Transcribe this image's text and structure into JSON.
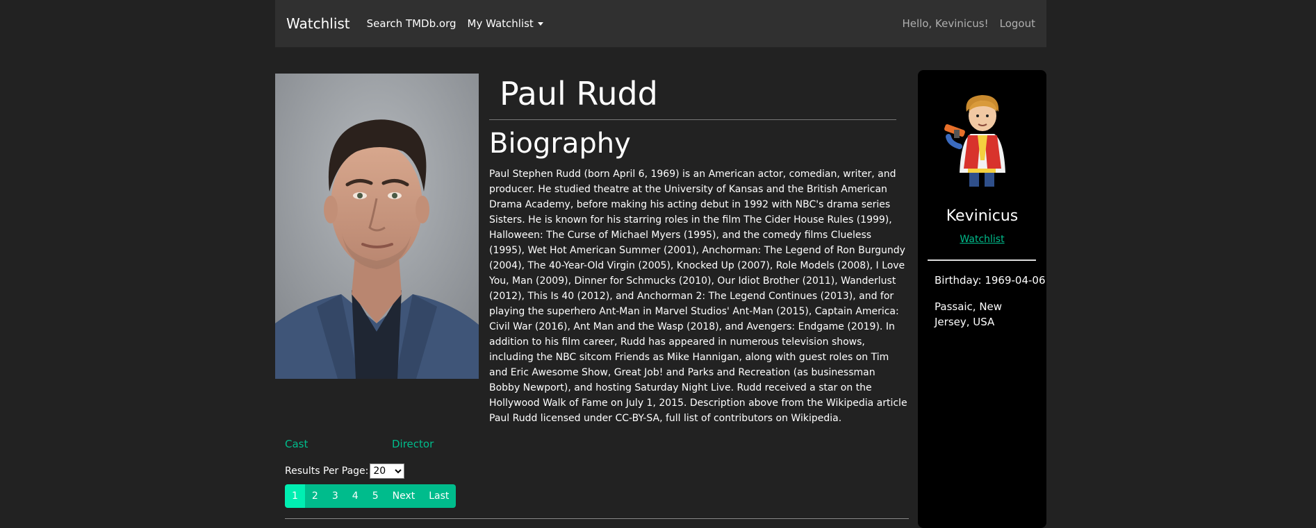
{
  "navbar": {
    "brand": "Watchlist",
    "search": "Search TMDb.org",
    "my_watchlist": "My Watchlist",
    "greeting": "Hello, Kevinicus!",
    "logout": "Logout"
  },
  "person": {
    "name": "Paul Rudd",
    "biography_heading": "Biography",
    "biography": "Paul Stephen Rudd (born April 6, 1969) is an American actor, comedian, writer, and producer. He studied theatre at the University of Kansas and the British American Drama Academy, before making his acting debut in 1992 with NBC's drama series Sisters. He is known for his starring roles in the film The Cider House Rules (1999), Halloween: The Curse of Michael Myers (1995), and the comedy films Clueless (1995), Wet Hot American Summer (2001), Anchorman: The Legend of Ron Burgundy (2004), The 40-Year-Old Virgin (2005), Knocked Up (2007), Role Models (2008), I Love You, Man (2009), Dinner for Schmucks (2010), Our Idiot Brother (2011), Wanderlust (2012), This Is 40 (2012), and Anchorman 2: The Legend Continues (2013), and for playing the superhero Ant-Man in Marvel Studios' Ant-Man (2015), Captain America: Civil War (2016), Ant Man and the Wasp (2018), and Avengers: Endgame (2019). In addition to his film career, Rudd has appeared in numerous television shows, including the NBC sitcom Friends as Mike Hannigan, along with guest roles on Tim and Eric Awesome Show, Great Job! and Parks and Recreation (as businessman Bobby Newport), and hosting Saturday Night Live. Rudd received a star on the Hollywood Walk of Fame on July 1, 2015. Description above from the Wikipedia article Paul Rudd licensed under CC-BY-SA, full list of contributors on Wikipedia."
  },
  "credits_tabs": {
    "cast": "Cast",
    "director": "Director"
  },
  "results_per_page": {
    "label": "Results Per Page:",
    "selected": "20"
  },
  "pagination": {
    "pages": [
      "1",
      "2",
      "3",
      "4",
      "5"
    ],
    "active": "1",
    "next": "Next",
    "last": "Last"
  },
  "sidebar": {
    "username": "Kevinicus",
    "watchlist_link": "Watchlist",
    "birthday": "Birthday: 1969-04-06",
    "place_of_birth": "Passaic, New Jersey, USA"
  },
  "colors": {
    "background": "#222222",
    "navbar": "#303030",
    "accent": "#00bc8c",
    "accent_active": "#00efb2",
    "sidebar": "#000000"
  },
  "icons": {
    "dropdown": "chevron-down-icon",
    "profile_photo": "person-photo",
    "user_avatar": "cartoon-avatar"
  }
}
